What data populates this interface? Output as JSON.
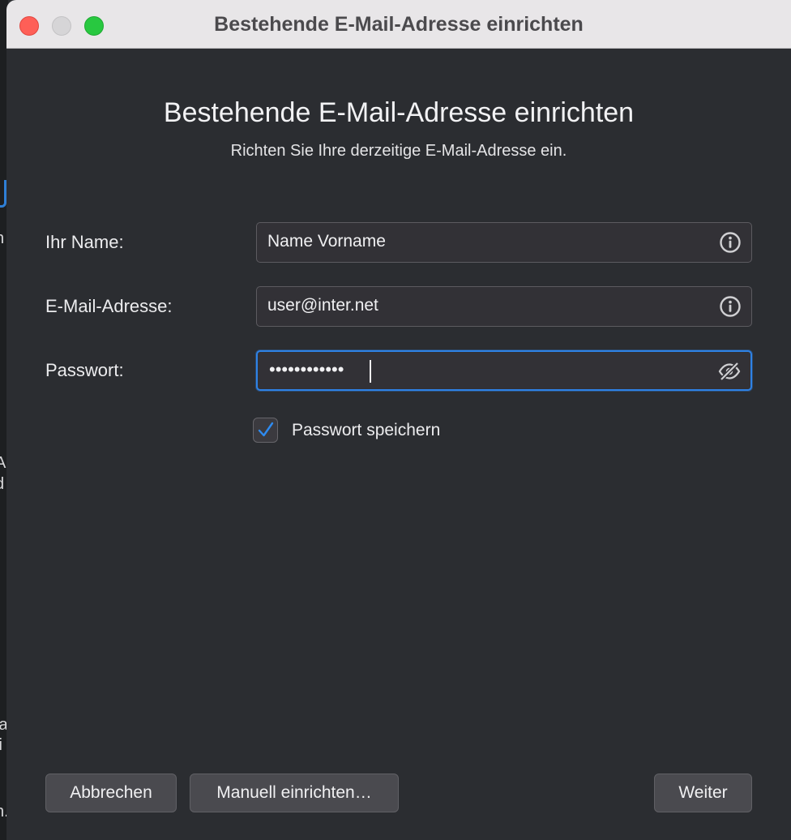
{
  "background_app": {
    "fragments": [
      "n",
      "A",
      "d",
      "la",
      "ii",
      "n."
    ]
  },
  "window": {
    "title": "Bestehende E-Mail-Adresse einrichten"
  },
  "header": {
    "title": "Bestehende E-Mail-Adresse einrichten",
    "subtitle": "Richten Sie Ihre derzeitige E-Mail-Adresse ein."
  },
  "form": {
    "name": {
      "label": "Ihr Name:",
      "value": "Name Vorname",
      "icon": "info-icon"
    },
    "email": {
      "label": "E-Mail-Adresse:",
      "value": "user@inter.net",
      "icon": "info-icon"
    },
    "password": {
      "label": "Passwort:",
      "masked_value": "••••••••••••",
      "icon": "eye-slash-icon"
    },
    "remember_password": {
      "label": "Passwort speichern",
      "checked": true
    }
  },
  "buttons": {
    "cancel": "Abbrechen",
    "manual": "Manuell einrichten…",
    "next": "Weiter"
  },
  "colors": {
    "accent": "#2e82e6",
    "window_bg": "#2b2d31",
    "close": "#fe5f57",
    "maximize": "#28c840"
  }
}
